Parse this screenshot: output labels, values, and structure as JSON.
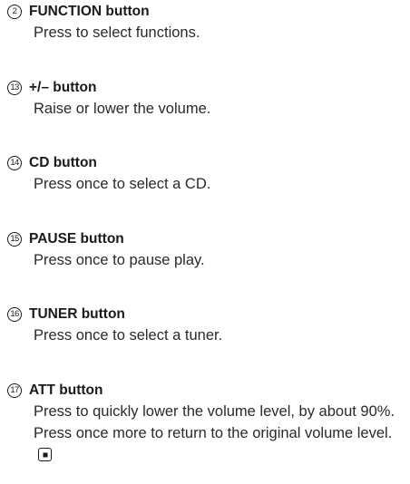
{
  "entries": [
    {
      "number": "2",
      "title": "FUNCTION button",
      "description": "Press to select functions."
    },
    {
      "number": "13",
      "title": "+/– button",
      "description": "Raise or lower the volume."
    },
    {
      "number": "14",
      "title": "CD button",
      "description": "Press once to select a CD."
    },
    {
      "number": "15",
      "title": "PAUSE button",
      "description": "Press once to pause play."
    },
    {
      "number": "16",
      "title": "TUNER button",
      "description": "Press once to select a tuner."
    },
    {
      "number": "17",
      "title": "ATT button",
      "description": "Press to quickly lower the volume level, by about 90%. Press once more to return to the original volume level."
    }
  ],
  "end_mark_icon": "end-of-section-icon"
}
